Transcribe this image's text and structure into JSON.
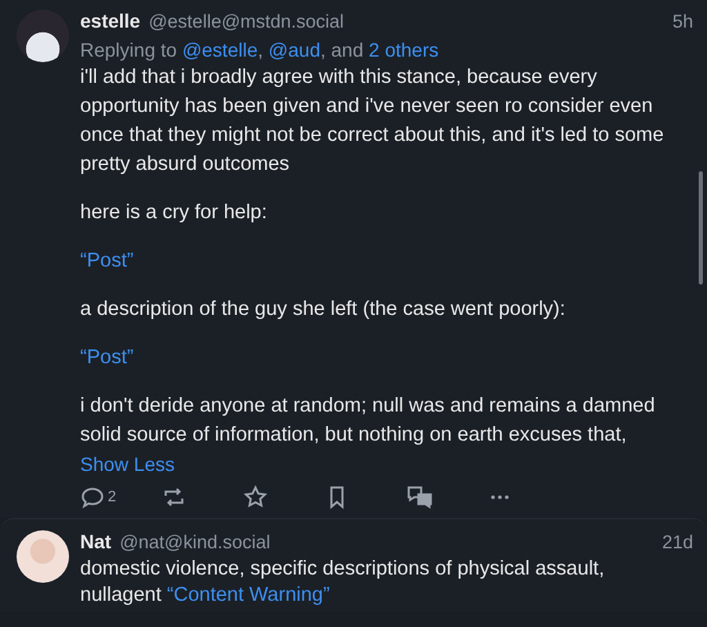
{
  "posts": [
    {
      "name": "estelle",
      "handle": "@estelle@mstdn.social",
      "time": "5h",
      "replying": {
        "prefix": "Replying to",
        "mentions": [
          {
            "text": "@estelle",
            "after": ","
          },
          {
            "text": "@aud",
            "after": ", and"
          },
          {
            "text": "2 others"
          }
        ]
      },
      "paragraphs": [
        {
          "kind": "text",
          "text": "i'll add that i broadly agree with this stance, because every opportunity has been given and i've never seen ro consider even once that they might not be correct about this, and it's led to some pretty absurd outcomes"
        },
        {
          "kind": "text",
          "text": "here is a cry for help:"
        },
        {
          "kind": "link",
          "text": "“Post”"
        },
        {
          "kind": "text",
          "text": "a description of the guy she left (the case went poorly):"
        },
        {
          "kind": "link",
          "text": "“Post”"
        },
        {
          "kind": "text",
          "text": "i don't deride anyone at random; null was and remains a damned solid source of information, but nothing on earth excuses that,"
        }
      ],
      "toggle": "Show Less",
      "reply_count": "2"
    },
    {
      "name": "Nat",
      "handle": "@nat@kind.social",
      "time": "21d",
      "content_warning": {
        "text": "domestic violence, specific descriptions of physical assault, nullagent",
        "link": "“Content Warning”"
      }
    }
  ]
}
